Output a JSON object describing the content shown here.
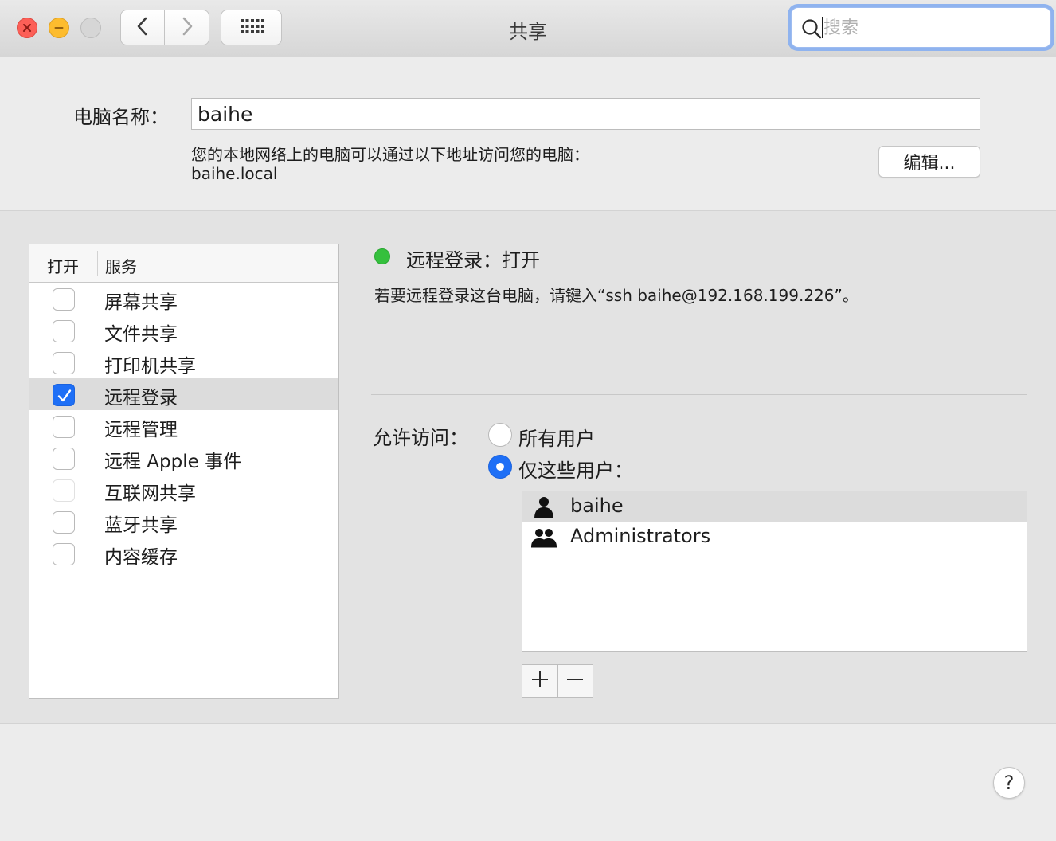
{
  "window": {
    "title": "共享",
    "search_placeholder": "搜索"
  },
  "computer_name": {
    "label": "电脑名称：",
    "value": "baihe",
    "hint": "您的本地网络上的电脑可以通过以下地址访问您的电脑：",
    "address": "baihe.local",
    "edit_label": "编辑..."
  },
  "services": {
    "col_on": "打开",
    "col_service": "服务",
    "items": [
      {
        "name": "屏幕共享",
        "checked": false,
        "selected": false,
        "disabled": false
      },
      {
        "name": "文件共享",
        "checked": false,
        "selected": false,
        "disabled": false
      },
      {
        "name": "打印机共享",
        "checked": false,
        "selected": false,
        "disabled": false
      },
      {
        "name": "远程登录",
        "checked": true,
        "selected": true,
        "disabled": false
      },
      {
        "name": "远程管理",
        "checked": false,
        "selected": false,
        "disabled": false
      },
      {
        "name": "远程 Apple 事件",
        "checked": false,
        "selected": false,
        "disabled": false
      },
      {
        "name": "互联网共享",
        "checked": false,
        "selected": false,
        "disabled": true
      },
      {
        "name": "蓝牙共享",
        "checked": false,
        "selected": false,
        "disabled": false
      },
      {
        "name": "内容缓存",
        "checked": false,
        "selected": false,
        "disabled": false
      }
    ]
  },
  "detail": {
    "status": "远程登录：打开",
    "status_color": "#35c03d",
    "instruction": "若要远程登录这台电脑，请键入“ssh baihe@192.168.199.226”。",
    "allow_label": "允许访问：",
    "radio_all": "所有用户",
    "radio_only": "仅这些用户：",
    "selected_option": "only",
    "users": [
      {
        "name": "baihe",
        "icon": "user-icon",
        "selected": true
      },
      {
        "name": "Administrators",
        "icon": "group-icon",
        "selected": false
      }
    ]
  },
  "help": {
    "label": "?"
  },
  "colors": {
    "accent": "#1e6ff6",
    "close": "#fc5f57",
    "minimize": "#fdbc2e"
  }
}
